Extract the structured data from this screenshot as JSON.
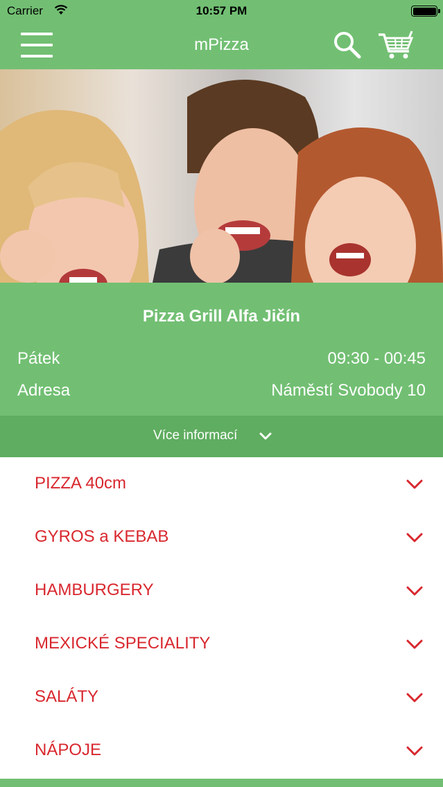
{
  "status_bar": {
    "carrier": "Carrier",
    "time": "10:57 PM"
  },
  "nav": {
    "title": "mPizza",
    "menu_icon": "hamburger-menu-icon",
    "search_icon": "search-icon",
    "cart_icon": "cart-icon"
  },
  "hero": {
    "image": "photo of three young people giving thumbs up"
  },
  "restaurant": {
    "name": "Pizza Grill Alfa Jičín",
    "rows": [
      {
        "label": "Pátek",
        "value": "09:30 - 00:45"
      },
      {
        "label": "Adresa",
        "value": "Náměstí Svobody 10"
      }
    ]
  },
  "more_info": {
    "label": "Více informací",
    "icon": "chevron-down-icon"
  },
  "categories": [
    {
      "label": "PIZZA 40cm"
    },
    {
      "label": "GYROS a KEBAB"
    },
    {
      "label": "HAMBURGERY"
    },
    {
      "label": "MEXICKÉ SPECIALITY"
    },
    {
      "label": "SALÁTY"
    },
    {
      "label": "NÁPOJE"
    }
  ],
  "colors": {
    "header_green": "#72bf73",
    "more_green": "#5fad60",
    "category_red": "#d8272e"
  }
}
